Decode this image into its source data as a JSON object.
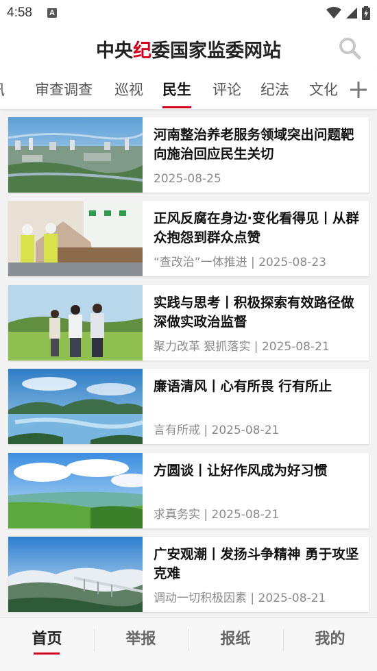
{
  "status_bar": {
    "time": "4:58",
    "notif_icon": "A"
  },
  "header": {
    "title_left": "中央",
    "title_red": "纪",
    "title_right": "委国家监委网站",
    "search_icon": "search-icon",
    "brand_red": "#d6001c"
  },
  "tabs": [
    {
      "label": "讯"
    },
    {
      "label": "审查调查"
    },
    {
      "label": "巡视"
    },
    {
      "label": "民生",
      "active": true
    },
    {
      "label": "评论"
    },
    {
      "label": "纪法"
    },
    {
      "label": "文化"
    }
  ],
  "articles": [
    {
      "title": "河南整治养老服务领域突出问题靶向施治回应民生关切",
      "meta": "2025-08-25"
    },
    {
      "title": "正风反腐在身边·变化看得见丨从群众抱怨到群众点赞",
      "meta": "“查改治”一体推进 | 2025-08-23"
    },
    {
      "title": "实践与思考丨积极探索有效路径做深做实政治监督",
      "meta": "聚力改革 狠抓落实 | 2025-08-21"
    },
    {
      "title": "廉语清风丨心有所畏 行有所止",
      "meta": "言有所戒 | 2025-08-21"
    },
    {
      "title": "方圆谈丨让好作风成为好习惯",
      "meta": "求真务实 | 2025-08-21"
    },
    {
      "title": "广安观潮丨发扬斗争精神 勇于攻坚克难",
      "meta": "调动一切积极因素 | 2025-08-21"
    }
  ],
  "bottom_nav": [
    {
      "label": "首页",
      "active": true
    },
    {
      "label": "举报"
    },
    {
      "label": "报纸"
    },
    {
      "label": "我的"
    }
  ]
}
